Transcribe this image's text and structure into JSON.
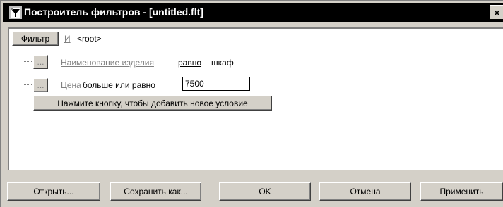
{
  "window": {
    "title": "Построитель фильтров - [untitled.flt]",
    "close_label": "×"
  },
  "filter_root": {
    "filter_button": "Фильтр",
    "operator": "И",
    "root_label": "<root>"
  },
  "conditions": [
    {
      "ellipsis": "...",
      "field": "Наименование изделия",
      "op": "равно",
      "value": "шкаф"
    },
    {
      "ellipsis": "...",
      "field": "Цена",
      "op": "больше или равно",
      "value": "7500"
    }
  ],
  "add_condition_button": "Нажмите кнопку, чтобы добавить новое условие",
  "buttons": {
    "open": "Открыть...",
    "save_as": "Сохранить как...",
    "ok": "OK",
    "cancel": "Отмена",
    "apply": "Применить"
  },
  "colors": {
    "dialog_face": "#d4d0c8",
    "titlebar": "#000000",
    "content_bg": "#ffffff",
    "muted_text": "#808080"
  }
}
